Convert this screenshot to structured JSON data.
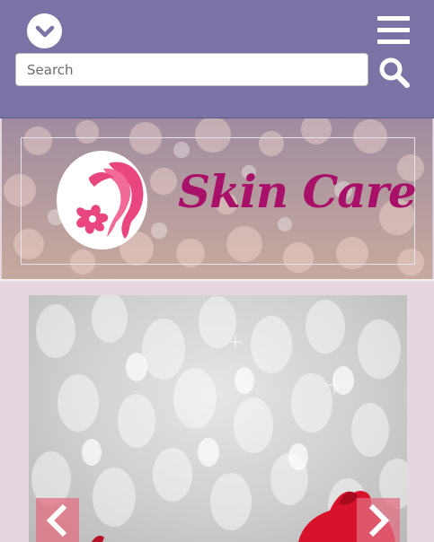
{
  "header": {
    "dropdown_icon": "chevron-down-icon",
    "menu_icon": "hamburger-menu-icon",
    "search_icon": "search-icon",
    "bg_color": "#7a73a6"
  },
  "search": {
    "placeholder": "Search",
    "value": ""
  },
  "banner": {
    "title": "Skin Care",
    "logo_icon": "woman-face-flower-icon",
    "title_color": "#a8106a"
  },
  "carousel": {
    "prev_icon": "chevron-left-icon",
    "next_icon": "chevron-right-icon",
    "arrow_color": "#e26e80"
  }
}
